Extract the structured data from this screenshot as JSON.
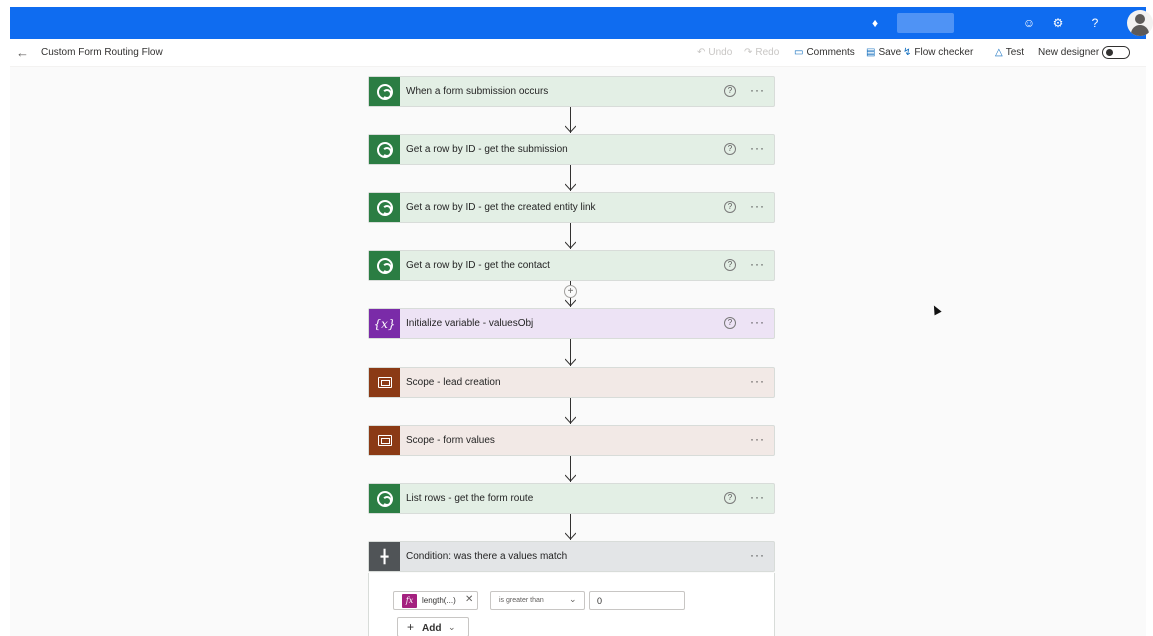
{
  "header": {
    "flow_title": "Custom Form Routing Flow",
    "help_glyph": "?",
    "icons": [
      "bell-icon",
      "smiley-icon",
      "gear-icon",
      "help-icon",
      "avatar"
    ]
  },
  "toolbar": {
    "undo": "Undo",
    "redo": "Redo",
    "comments": "Comments",
    "save": "Save",
    "flow_checker": "Flow checker",
    "test": "Test",
    "new_designer": "New designer"
  },
  "steps": [
    {
      "title": "When a form submission occurs",
      "kind": "dataverse",
      "help": true
    },
    {
      "title": "Get a row by ID - get the submission",
      "kind": "dataverse",
      "help": true
    },
    {
      "title": "Get a row by ID - get the created entity link",
      "kind": "dataverse",
      "help": true
    },
    {
      "title": "Get a row by ID - get the contact",
      "kind": "dataverse",
      "help": true
    },
    {
      "title": "Initialize variable - valuesObj",
      "kind": "variable",
      "help": true,
      "icon_text": "{x}"
    },
    {
      "title": "Scope - lead creation",
      "kind": "scope",
      "help": false
    },
    {
      "title": "Scope - form values",
      "kind": "scope",
      "help": false
    },
    {
      "title": "List rows - get the form route",
      "kind": "dataverse",
      "help": true
    },
    {
      "title": "Condition: was there a values match",
      "kind": "condition",
      "help": false
    }
  ],
  "condition": {
    "fx_label": "length(...)",
    "fx_glyph": "fx",
    "operator": "is greater than",
    "value": "0",
    "add_label": "Add"
  },
  "colors": {
    "topbar": "#0f6cf0",
    "dataverse": "#2b7d43",
    "variable": "#7a2ba8",
    "scope": "#8b3a15",
    "condition": "#505457",
    "fx": "#a4217f"
  }
}
